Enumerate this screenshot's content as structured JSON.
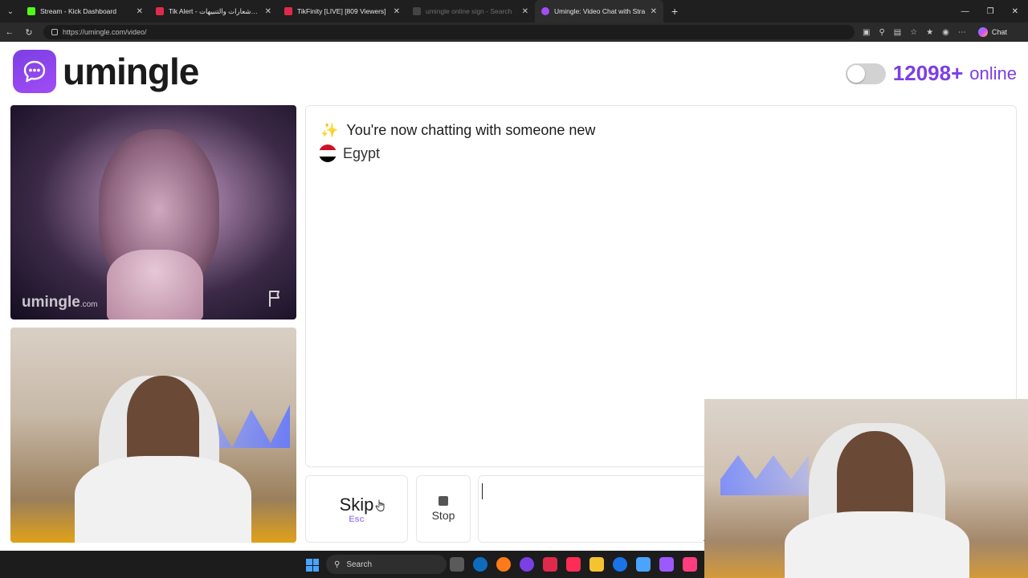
{
  "browser": {
    "tabs": [
      {
        "label": "Stream - Kick Dashboard",
        "color": "#53fc18",
        "active": false,
        "dim": false
      },
      {
        "label": "Tik Alert - منصة الإشعارات والتنبيهات",
        "color": "#e02a4b",
        "active": false,
        "dim": false
      },
      {
        "label": "TikFinity [LIVE] [809 Viewers]",
        "color": "#e02a4b",
        "active": false,
        "dim": false
      },
      {
        "label": "umingle online sign - Search",
        "color": "#444444",
        "active": false,
        "dim": true
      },
      {
        "label": "Umingle: Video Chat with Stra",
        "color": "#a24cf5",
        "active": true,
        "dim": false
      }
    ],
    "new_tab": "+",
    "url": "https://umingle.com/video/",
    "chat_label": "Chat"
  },
  "header": {
    "brand": "umingle",
    "online_count": "12098+",
    "online_label": "online",
    "theme_toggle_on": false
  },
  "stranger_video": {
    "watermark": "umingle",
    "watermark_suffix": ".com"
  },
  "chat": {
    "status_message": "You're now chatting with someone new",
    "country": "Egypt",
    "country_flag_colors": [
      "#ce1126",
      "#ffffff",
      "#000000"
    ]
  },
  "controls": {
    "skip_label": "Skip",
    "skip_shortcut": "Esc",
    "stop_label": "Stop",
    "message_placeholder": ""
  },
  "taskbar": {
    "search_label": "Search",
    "pinned_icon_colors": [
      "#0f6cbd",
      "#ff7a18",
      "#7b3fe4",
      "#e02a4b",
      "#ff2d55",
      "#f4c430",
      "#1a73e8",
      "#4aa3ff",
      "#9b59ff",
      "#ff3d7f"
    ]
  },
  "colors": {
    "accent": "#7b3fe4",
    "accent_light": "#a98ce8"
  }
}
